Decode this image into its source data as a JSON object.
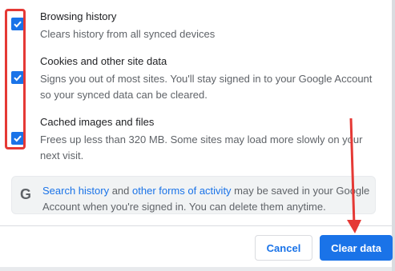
{
  "items": [
    {
      "title": "Browsing history",
      "desc_lines": [
        "Clears history from all synced devices"
      ],
      "checked": true
    },
    {
      "title": "Cookies and other site data",
      "desc_lines": [
        "Signs you out of most sites. You'll stay signed in to your Google Account",
        "so your synced data can be cleared."
      ],
      "checked": true
    },
    {
      "title": "Cached images and files",
      "desc_lines": [
        "Frees up less than 320 MB. Some sites may load more slowly on your",
        "next visit."
      ],
      "checked": true
    }
  ],
  "info": {
    "icon": "google-g-icon",
    "link1": "Search history",
    "mid1": " and ",
    "link2": "other forms of activity",
    "rest1": " may be saved in your Google",
    "line2": "Account when you're signed in. You can delete them anytime."
  },
  "buttons": {
    "cancel": "Cancel",
    "clear": "Clear data"
  },
  "colors": {
    "accent": "#1a73e8",
    "annotation": "#e53935"
  }
}
